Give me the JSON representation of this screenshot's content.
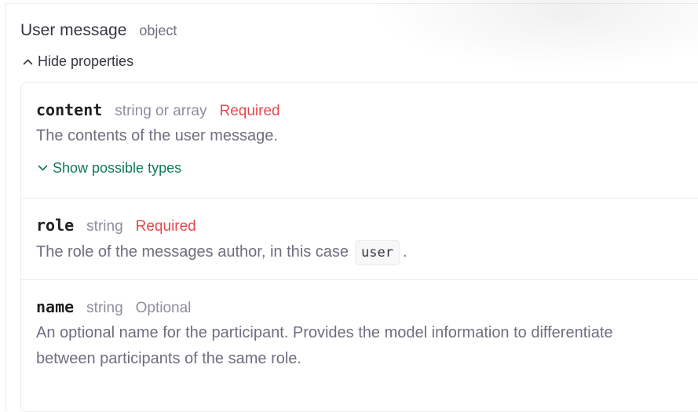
{
  "header": {
    "title": "User message",
    "type": "object"
  },
  "toggles": {
    "hide_properties": "Hide properties",
    "show_possible_types": "Show possible types"
  },
  "properties": [
    {
      "name": "content",
      "type": "string or array",
      "status": "Required",
      "description": "The contents of the user message."
    },
    {
      "name": "role",
      "type": "string",
      "status": "Required",
      "description_prefix": "The role of the messages author, in this case",
      "code": "user",
      "description_suffix": "."
    },
    {
      "name": "name",
      "type": "string",
      "status": "Optional",
      "description_line1": "An optional name for the participant. Provides the model information to differentiate",
      "description_line2": "between participants of the same role."
    }
  ],
  "colors": {
    "required": "#e5484d",
    "link_green": "#0f7a55",
    "muted": "#6e6e80"
  }
}
